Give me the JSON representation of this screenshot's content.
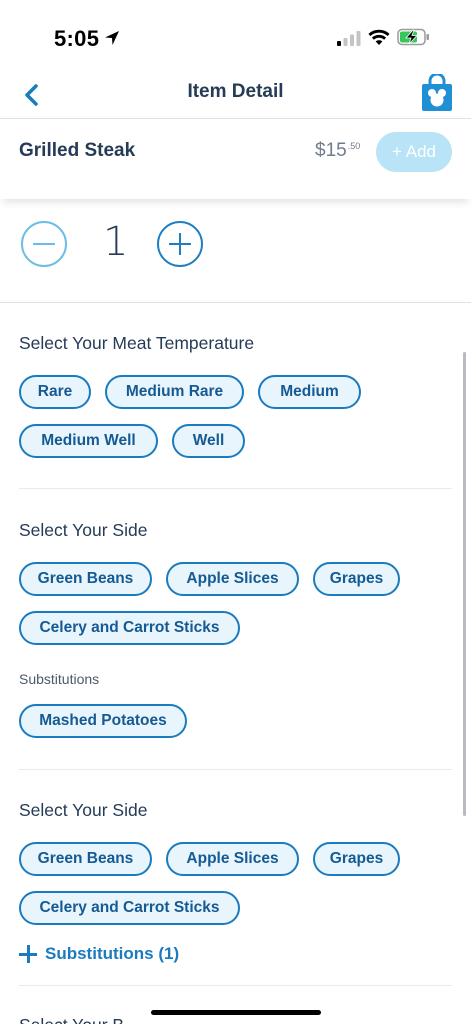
{
  "status": {
    "time": "5:05"
  },
  "nav": {
    "title": "Item Detail",
    "back_icon": "chevron-left-icon",
    "bag_icon": "shopping-bag-icon"
  },
  "item": {
    "name": "Grilled Steak",
    "price_main": "$15",
    "price_cents": ".50",
    "add_label": "+ Add"
  },
  "quantity": {
    "value": "1"
  },
  "sections": [
    {
      "title": "Select Your Meat Temperature",
      "options": [
        "Rare",
        "Medium Rare",
        "Medium",
        "Medium Well",
        "Well"
      ]
    },
    {
      "title": "Select Your Side",
      "options": [
        "Green Beans",
        "Apple Slices",
        "Grapes",
        "Celery and Carrot Sticks"
      ],
      "substitutions_label": "Substitutions",
      "substitutions": [
        "Mashed Potatoes"
      ]
    },
    {
      "title": "Select Your Side",
      "options": [
        "Green Beans",
        "Apple Slices",
        "Grapes",
        "Celery and Carrot Sticks"
      ],
      "substitutions_link": "Substitutions (1)"
    },
    {
      "title": "Select Your B"
    }
  ],
  "colors": {
    "accent": "#1a7bbf",
    "chip_background": "#e8f5fc",
    "title_text": "#253b56",
    "add_button_disabled": "#b9e3f6",
    "bag_icon": "#1f8fd6"
  }
}
